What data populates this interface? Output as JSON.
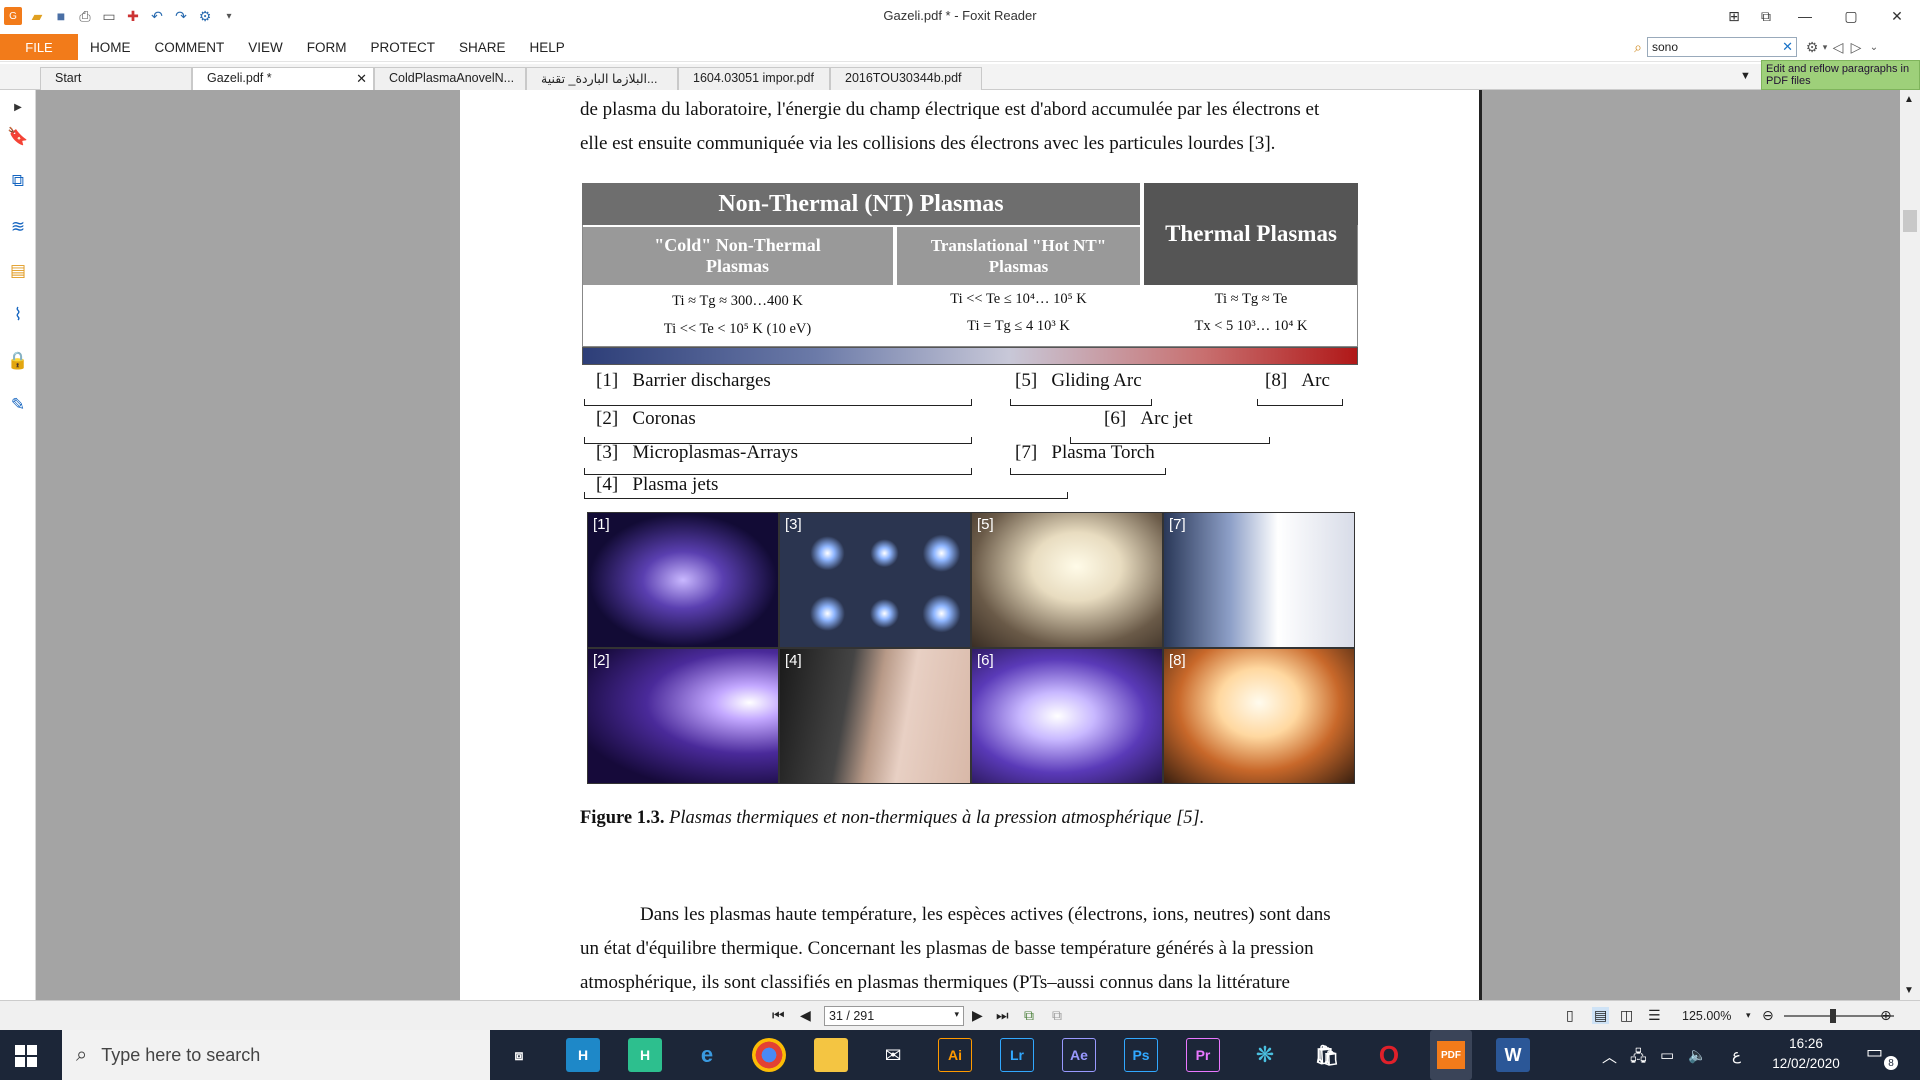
{
  "window": {
    "title": "Gazeli.pdf * - Foxit Reader"
  },
  "ribbon": {
    "file": "FILE",
    "tabs": [
      "HOME",
      "COMMENT",
      "VIEW",
      "FORM",
      "PROTECT",
      "SHARE",
      "HELP"
    ],
    "search_value": "sono",
    "reflow_tip": "Edit and reflow paragraphs in PDF files"
  },
  "doc_tabs": [
    {
      "label": "Start"
    },
    {
      "label": "Gazeli.pdf *"
    },
    {
      "label": "ColdPlasmaAnovelN..."
    },
    {
      "label": "البلازما الباردة_ تقنية..."
    },
    {
      "label": "1604.03051 impor.pdf"
    },
    {
      "label": "2016TOU30344b.pdf"
    }
  ],
  "page": {
    "para1_line1": "de plasma du laboratoire, l'énergie du champ électrique est d'abord accumulée par les électrons et",
    "para1_line2": "elle est ensuite communiquée via les collisions des électrons avec les particules lourdes [3].",
    "table": {
      "nt_header": "Non-Thermal (NT) Plasmas",
      "thermal_header": "Thermal Plasmas",
      "cold_header": "\"Cold\" Non-Thermal Plasmas",
      "hot_header": "Translational \"Hot NT\" Plasmas",
      "cold_l1": "Ti ≈ Tg ≈ 300…400 K",
      "cold_l2": "Ti << Te < 10⁵ K (10 eV)",
      "hot_l1": "Ti << Te ≤ 10⁴… 10⁵ K",
      "hot_l2": "Ti = Tg ≤ 4 10³ K",
      "th_l1": "Ti ≈ Tg ≈ Te",
      "th_l2": "Tx < 5 10³… 10⁴ K"
    },
    "brackets": [
      {
        "num": "[1]",
        "label": "Barrier discharges"
      },
      {
        "num": "[2]",
        "label": "Coronas"
      },
      {
        "num": "[3]",
        "label": "Microplasmas-Arrays"
      },
      {
        "num": "[4]",
        "label": "Plasma jets"
      },
      {
        "num": "[5]",
        "label": "Gliding Arc"
      },
      {
        "num": "[6]",
        "label": "Arc jet"
      },
      {
        "num": "[7]",
        "label": "Plasma Torch"
      },
      {
        "num": "[8]",
        "label": "Arc"
      }
    ],
    "photo_labels": [
      "[1]",
      "[3]",
      "[5]",
      "[7]",
      "[2]",
      "[4]",
      "[6]",
      "[8]"
    ],
    "caption_bold": "Figure 1.3.",
    "caption_italic": " Plasmas thermiques et non-thermiques à la pression atmosphérique [5].",
    "para2_line1": "Dans les plasmas haute température, les espèces actives (électrons, ions, neutres) sont dans",
    "para2_line2": "un état d'équilibre thermique. Concernant les plasmas de basse température générés à la pression",
    "para2_line3": "atmosphérique, ils sont classifiés en plasmas thermiques (PTs–aussi connus dans la littérature"
  },
  "nav": {
    "page": "31 / 291",
    "zoom": "125.00%"
  },
  "taskbar": {
    "search_placeholder": "Type here to search",
    "time": "16:26",
    "date": "12/02/2020",
    "lang": "ع",
    "notif_count": "8",
    "apps": [
      "Ai",
      "Lr",
      "Ae",
      "Ps",
      "Pr"
    ]
  },
  "colors": {
    "accent": "#f27b1a",
    "nt_dark": "#6e6e6e",
    "nt_light": "#999999",
    "thermal": "#555555"
  }
}
